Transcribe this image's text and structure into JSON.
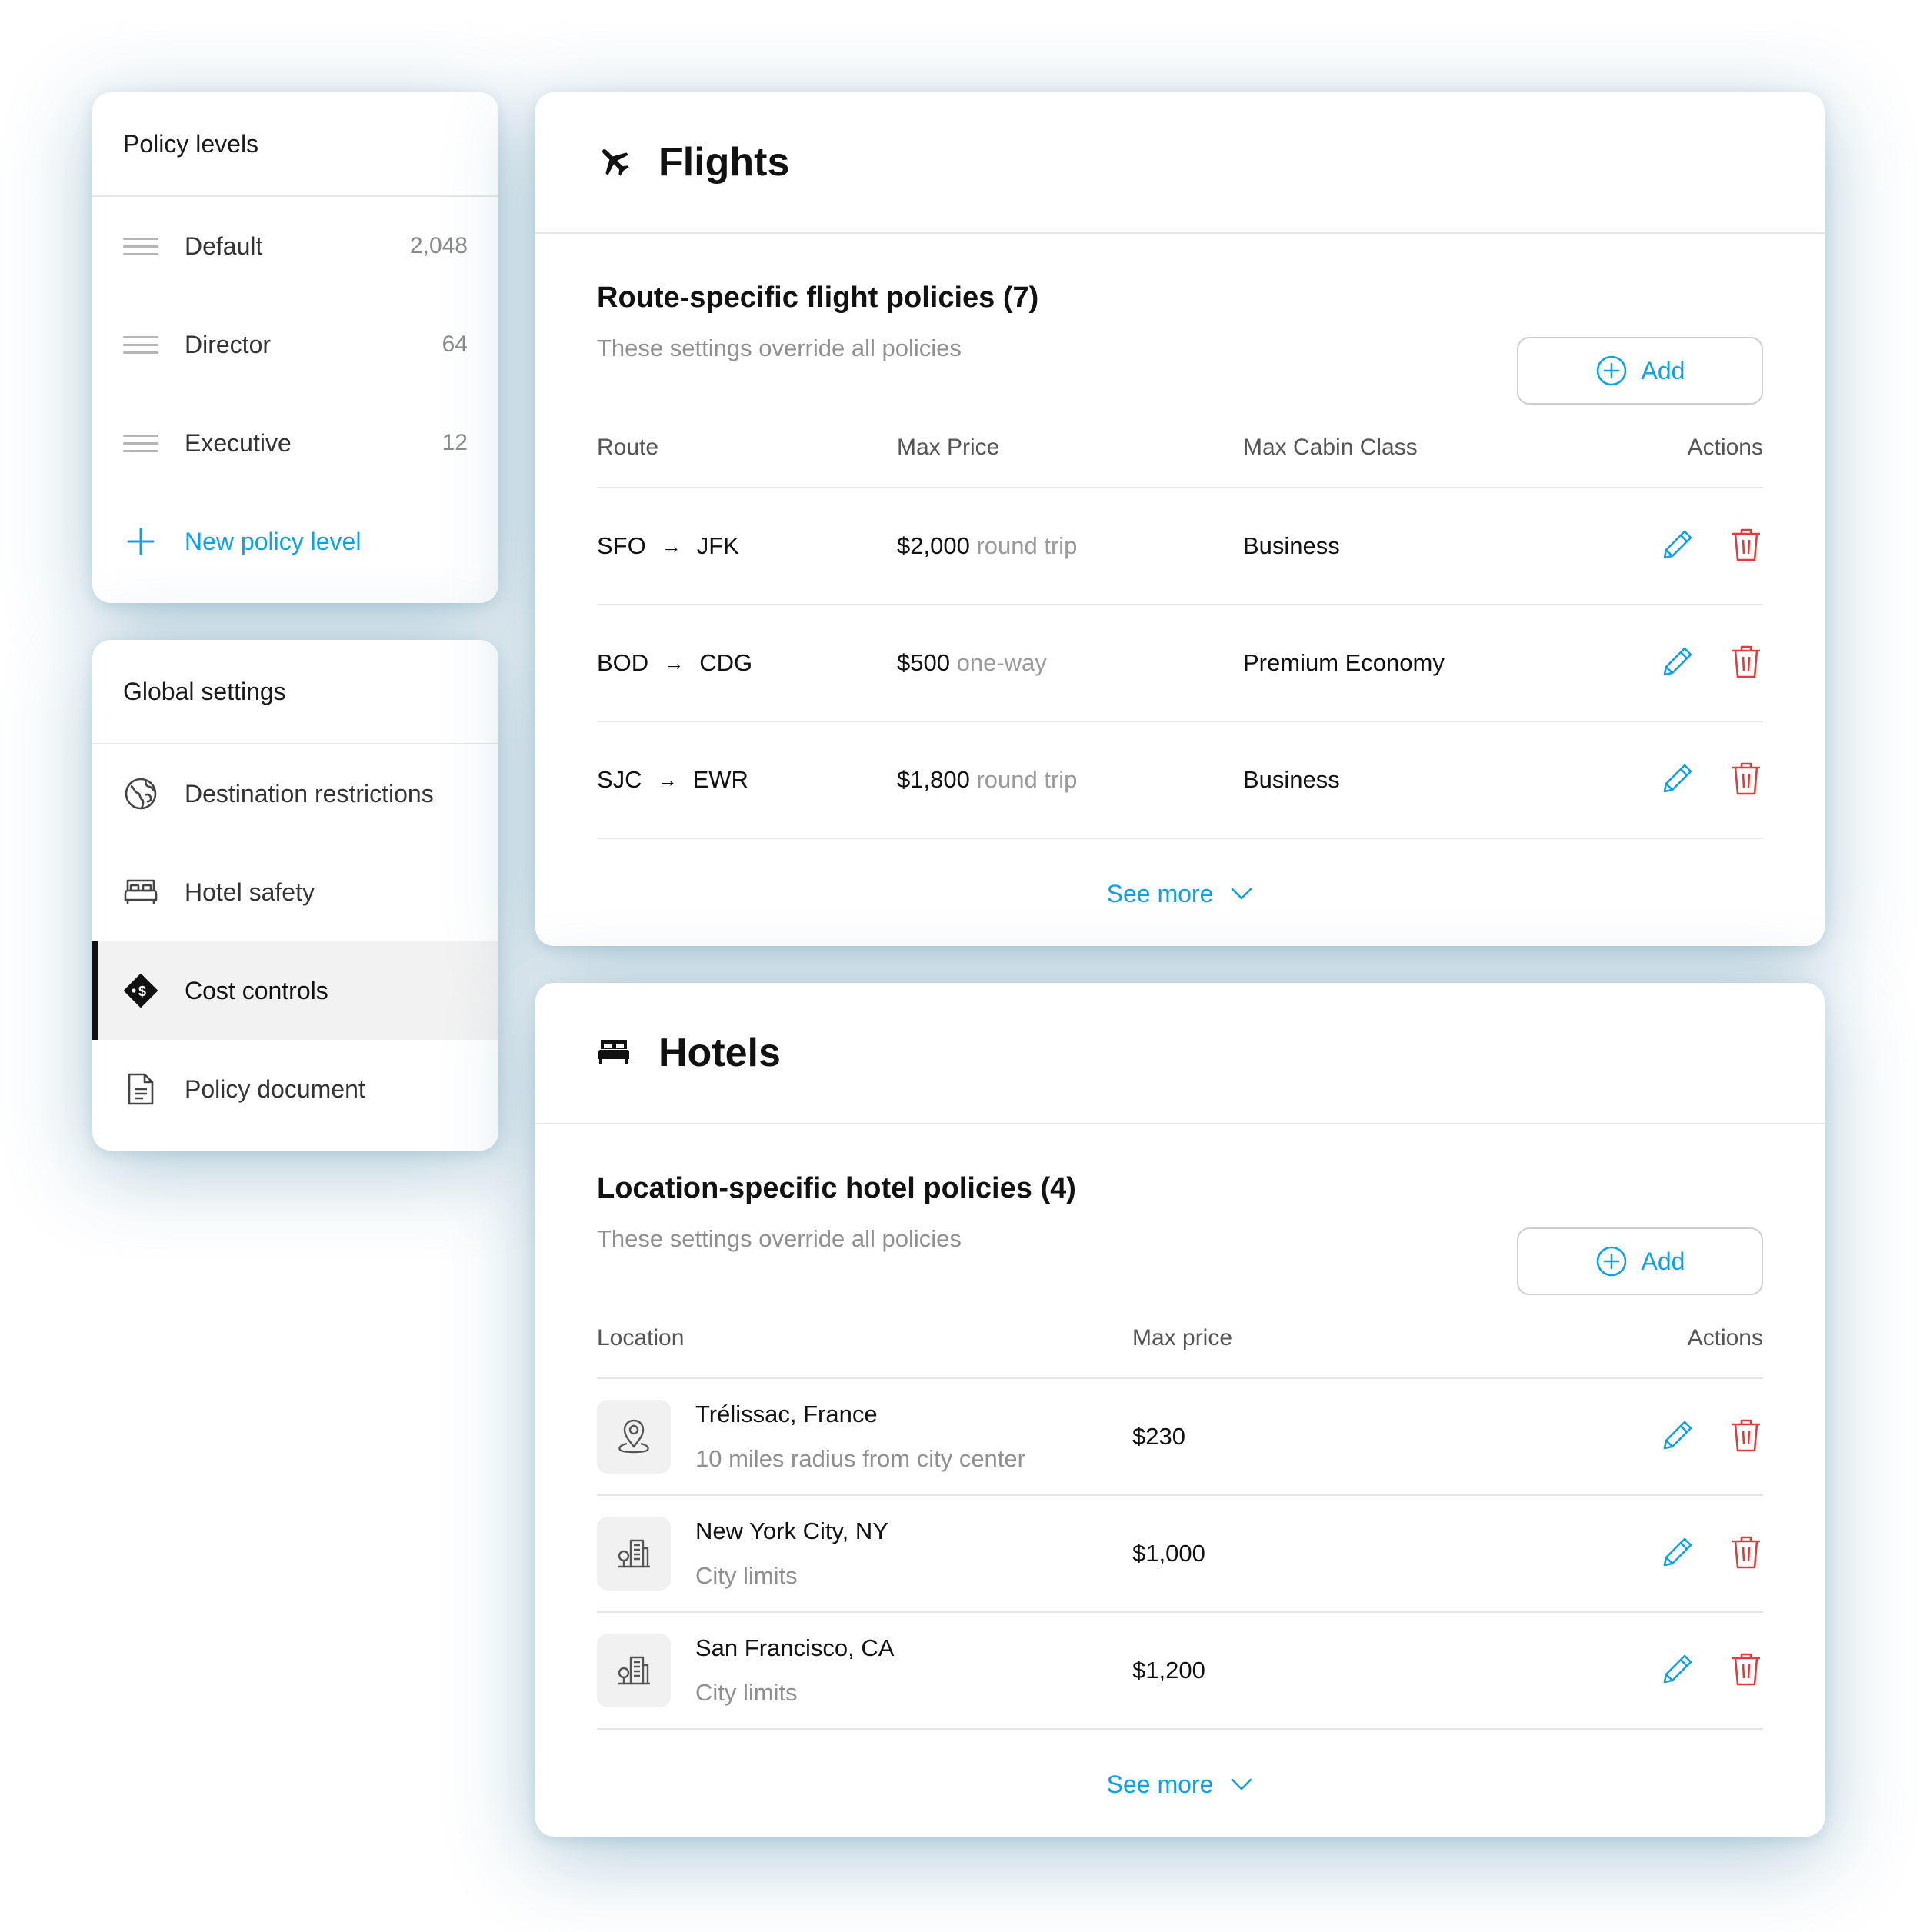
{
  "policy_levels": {
    "title": "Policy levels",
    "items": [
      {
        "label": "Default",
        "count": "2,048"
      },
      {
        "label": "Director",
        "count": "64"
      },
      {
        "label": "Executive",
        "count": "12"
      }
    ],
    "new_label": "New policy level"
  },
  "global_settings": {
    "title": "Global settings",
    "items": [
      {
        "label": "Destination restrictions",
        "icon": "globe-icon"
      },
      {
        "label": "Hotel safety",
        "icon": "bed-icon"
      },
      {
        "label": "Cost controls",
        "icon": "price-tag-icon",
        "active": true
      },
      {
        "label": "Policy document",
        "icon": "document-icon"
      }
    ]
  },
  "flights": {
    "title": "Flights",
    "section_title": "Route-specific flight policies (7)",
    "section_sub": "These settings override all policies",
    "add_label": "Add",
    "columns": [
      "Route",
      "Max Price",
      "Max Cabin Class",
      "Actions"
    ],
    "rows": [
      {
        "from": "SFO",
        "to": "JFK",
        "price": "$2,000",
        "unit": "round trip",
        "cabin": "Business"
      },
      {
        "from": "BOD",
        "to": "CDG",
        "price": "$500",
        "unit": "one-way",
        "cabin": "Premium Economy"
      },
      {
        "from": "SJC",
        "to": "EWR",
        "price": "$1,800",
        "unit": "round trip",
        "cabin": "Business"
      }
    ],
    "arrow": "→",
    "see_more": "See more"
  },
  "hotels": {
    "title": "Hotels",
    "section_title": "Location-specific hotel policies (4)",
    "section_sub": "These settings override all policies",
    "add_label": "Add",
    "columns": [
      "Location",
      "Max price",
      "Actions"
    ],
    "rows": [
      {
        "name": "Trélissac, France",
        "sub": "10 miles radius from city center",
        "price": "$230",
        "icon": "map-pin-icon"
      },
      {
        "name": "New York City, NY",
        "sub": "City limits",
        "price": "$1,000",
        "icon": "city-icon"
      },
      {
        "name": "San Francisco, CA",
        "sub": "City limits",
        "price": "$1,200",
        "icon": "city-icon"
      }
    ],
    "see_more": "See more"
  },
  "colors": {
    "accent": "#0fa1e0",
    "danger": "#e23b3b",
    "active_bar": "#111111"
  }
}
